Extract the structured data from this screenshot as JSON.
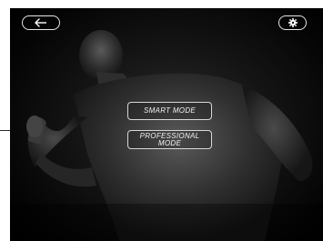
{
  "header": {
    "back_icon": "arrow-left-icon",
    "settings_icon": "gear-icon"
  },
  "modes": {
    "smart_label": "SMART MODE",
    "professional_label": "PROFESSIONAL MODE"
  },
  "colors": {
    "background": "#000000",
    "button_border": "#d8d8d8",
    "text": "#f2f2f2"
  }
}
